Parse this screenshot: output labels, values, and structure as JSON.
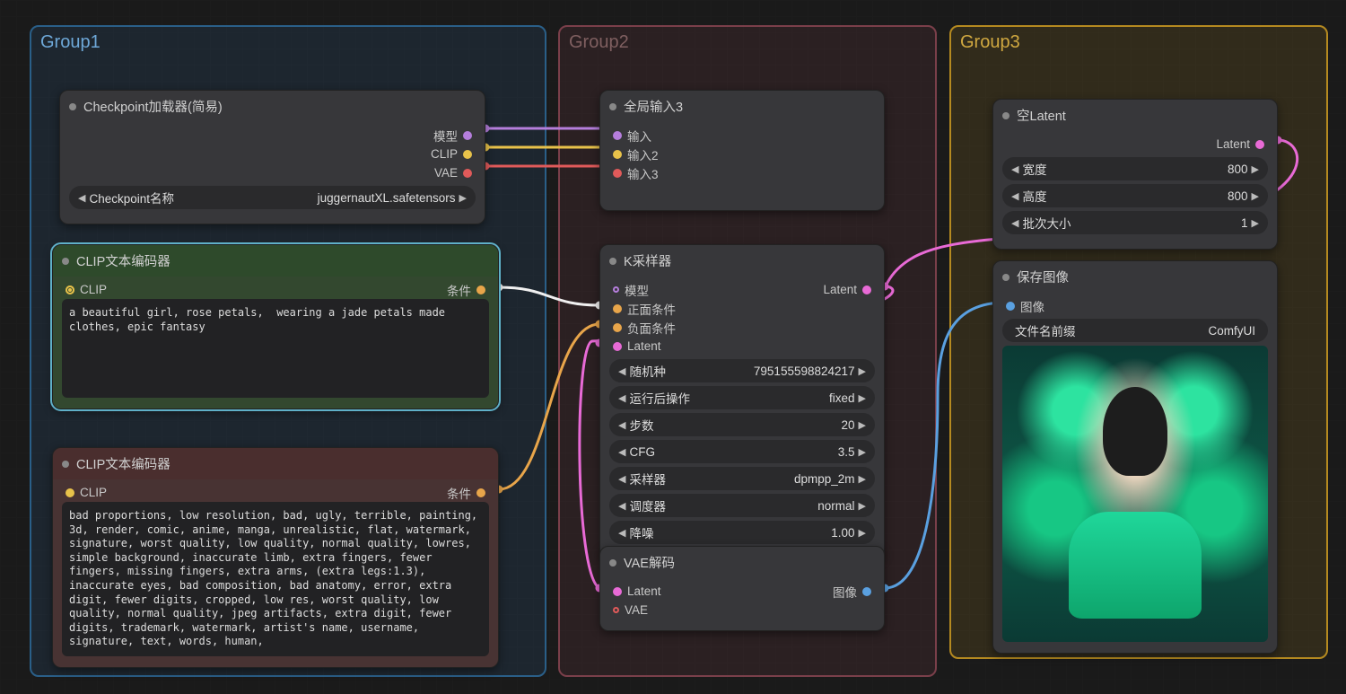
{
  "groups": {
    "g1": "Group1",
    "g2": "Group2",
    "g3": "Group3"
  },
  "checkpoint": {
    "title": "Checkpoint加载器(简易)",
    "outputs": {
      "model": "模型",
      "clip": "CLIP",
      "vae": "VAE"
    },
    "ckpt_label": "Checkpoint名称",
    "ckpt_value": "juggernautXL.safetensors"
  },
  "clip_pos": {
    "title": "CLIP文本编码器",
    "in": "CLIP",
    "out": "条件",
    "text": "a beautiful girl, rose petals,  wearing a jade petals made clothes, epic fantasy"
  },
  "clip_neg": {
    "title": "CLIP文本编码器",
    "in": "CLIP",
    "out": "条件",
    "text": "bad proportions, low resolution, bad, ugly, terrible, painting, 3d, render, comic, anime, manga, unrealistic, flat, watermark, signature, worst quality, low quality, normal quality, lowres, simple background, inaccurate limb, extra fingers, fewer fingers, missing fingers, extra arms, (extra legs:1.3), inaccurate eyes, bad composition, bad anatomy, error, extra digit, fewer digits, cropped, low res, worst quality, low quality, normal quality, jpeg artifacts, extra digit, fewer digits, trademark, watermark, artist's name, username, signature, text, words, human,"
  },
  "reroute": {
    "title": "全局输入3",
    "in1": "输入",
    "in2": "输入2",
    "in3": "输入3"
  },
  "ksampler": {
    "title": "K采样器",
    "in_model": "模型",
    "in_pos": "正面条件",
    "in_neg": "负面条件",
    "in_latent": "Latent",
    "out_latent": "Latent",
    "seed_l": "随机种",
    "seed_v": "795155598824217",
    "after_l": "运行后操作",
    "after_v": "fixed",
    "steps_l": "步数",
    "steps_v": "20",
    "cfg_l": "CFG",
    "cfg_v": "3.5",
    "sampler_l": "采样器",
    "sampler_v": "dpmpp_2m",
    "sched_l": "调度器",
    "sched_v": "normal",
    "denoise_l": "降噪",
    "denoise_v": "1.00"
  },
  "vae_decode": {
    "title": "VAE解码",
    "in_latent": "Latent",
    "in_vae": "VAE",
    "out_img": "图像"
  },
  "empty_latent": {
    "title": "空Latent",
    "out": "Latent",
    "w_l": "宽度",
    "w_v": "800",
    "h_l": "高度",
    "h_v": "800",
    "b_l": "批次大小",
    "b_v": "1"
  },
  "save": {
    "title": "保存图像",
    "in_img": "图像",
    "prefix_l": "文件名前缀",
    "prefix_v": "ComfyUI"
  },
  "colors": {
    "model": "#b57edc",
    "clip": "#e8c24a",
    "vae": "#e05a5a",
    "cond": "#e8a54a",
    "latent": "#e86ad6",
    "image": "#5aa0e0",
    "white": "#f0f0f0"
  }
}
